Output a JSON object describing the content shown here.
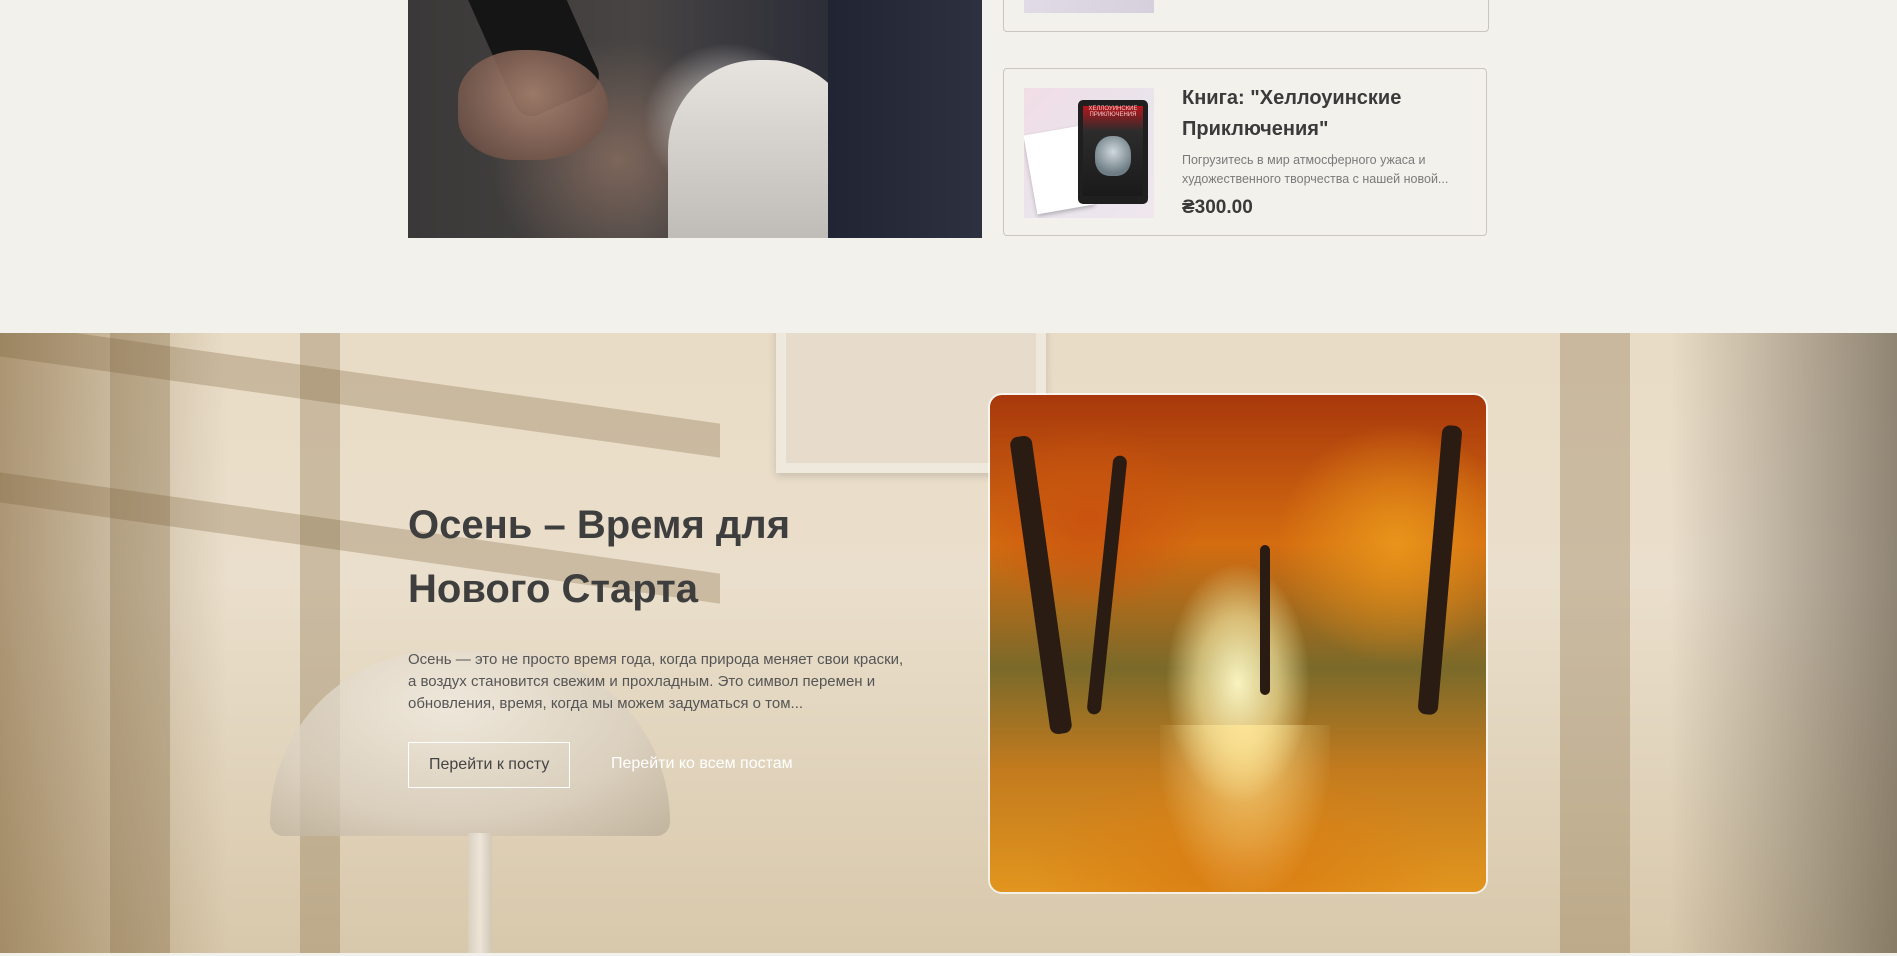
{
  "top": {
    "hero_image": "woman-with-phone-photo",
    "product": {
      "title": "Книга: \"Хеллоуинские Приключения\"",
      "desc_line1": "Погрузитесь в мир атмосферного ужаса и",
      "desc_line2": "художественного творчества с нашей новой...",
      "price": "₴300.00",
      "thumb_text": "ХЕЛЛОУИНСКИЕ ПРИКЛЮЧЕНИЯ"
    }
  },
  "blog": {
    "title": "Осень – Время для Нового Старта",
    "text": "Осень — это не просто время года, когда природа меняет свои краски, а воздух становится свежим и прохладным. Это символ перемен и обновления, время, когда мы можем задуматься о том...",
    "btn_post": "Перейти к посту",
    "btn_all": "Перейти ко всем постам",
    "image": "autumn-forest-path-photo"
  },
  "colors": {
    "page_bg": "#f3f1eb",
    "text_dark": "#3a3a3a",
    "card_border": "#c9c6bf"
  }
}
